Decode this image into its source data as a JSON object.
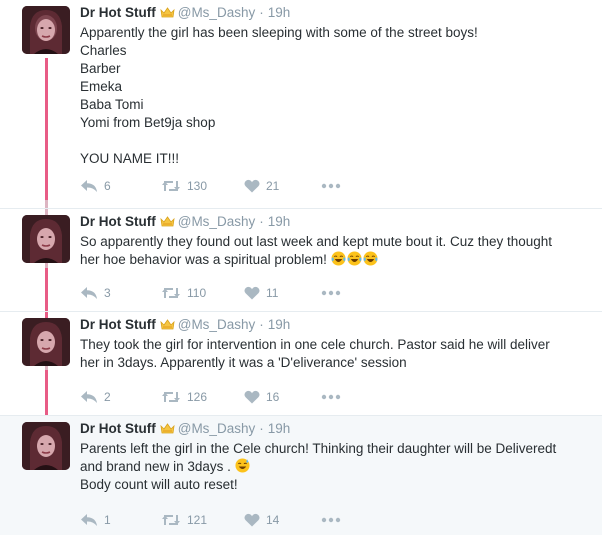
{
  "colors": {
    "thread_line": "#e85c86",
    "name_text": "#292f33",
    "meta_text": "#8899a6",
    "highlight_background": "#f5f8fa"
  },
  "icons": [
    "crown-icon",
    "reply-icon",
    "retweet-icon",
    "like-icon",
    "more-icon",
    "laughing-tears-emoji",
    "sweat-smile-emoji"
  ],
  "tweets": [
    {
      "author": "Dr Hot Stuff",
      "handle": "@Ms_Dashy",
      "separator": "·",
      "time": "19h",
      "text_lines": [
        "Apparently the girl has been sleeping with some of the street boys!",
        "Charles",
        "Barber",
        "Emeka",
        "Baba Tomi",
        "Yomi from Bet9ja shop",
        "",
        "YOU NAME IT!!!"
      ],
      "replies": "6",
      "retweets": "130",
      "likes": "21"
    },
    {
      "author": "Dr Hot Stuff",
      "handle": "@Ms_Dashy",
      "separator": "·",
      "time": "19h",
      "text_lines": [
        "So apparently they found out last week and kept mute bout it. Cuz they thought",
        "her hoe behavior was a spiritual problem!"
      ],
      "emoji_count": 3,
      "replies": "3",
      "retweets": "110",
      "likes": "11"
    },
    {
      "author": "Dr Hot Stuff",
      "handle": "@Ms_Dashy",
      "separator": "·",
      "time": "19h",
      "text_lines": [
        "They took the girl for intervention in one cele church. Pastor said he will deliver",
        "her in 3days. Apparently it was a 'D'eliverance' session"
      ],
      "replies": "2",
      "retweets": "126",
      "likes": "16"
    },
    {
      "author": "Dr Hot Stuff",
      "handle": "@Ms_Dashy",
      "separator": "·",
      "time": "19h",
      "text_lines": [
        "Parents left the girl in the Cele church! Thinking their daughter will be Deliveredt",
        "and brand new in 3days .",
        "Body count will auto reset!"
      ],
      "replies": "1",
      "retweets": "121",
      "likes": "14"
    }
  ]
}
